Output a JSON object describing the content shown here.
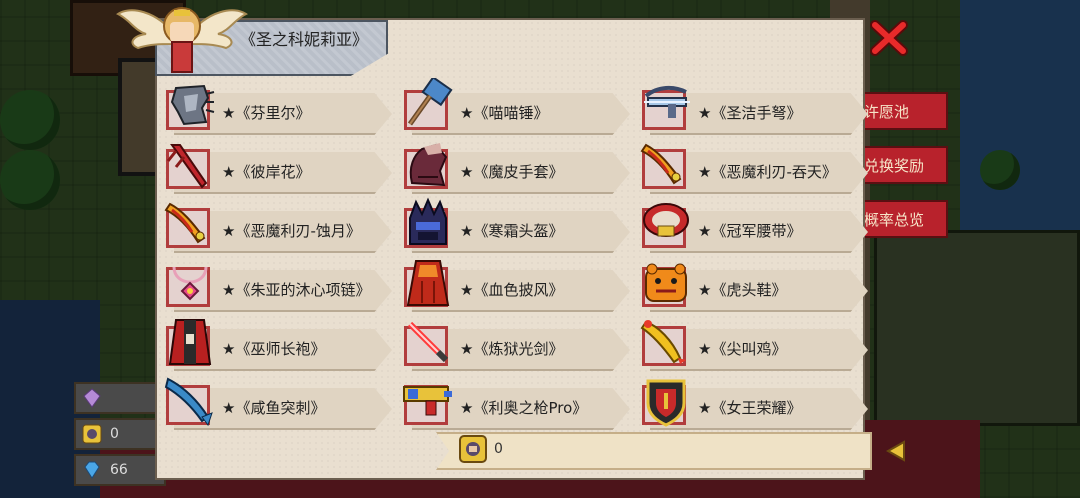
{
  "title": "《圣之科妮莉亚》",
  "items": [
    {
      "label": "★《芬里尔》",
      "icon": "claw-gauntlet-icon"
    },
    {
      "label": "★《喵喵锤》",
      "icon": "hammer-icon"
    },
    {
      "label": "★《圣洁手弩》",
      "icon": "crossbow-icon"
    },
    {
      "label": "★《彼岸花》",
      "icon": "red-blade-icon"
    },
    {
      "label": "★《魔皮手套》",
      "icon": "glove-icon"
    },
    {
      "label": "★《恶魔利刃-吞天》",
      "icon": "demon-blade-icon"
    },
    {
      "label": "★《恶魔利刃-蚀月》",
      "icon": "demon-blade-icon"
    },
    {
      "label": "★《寒霜头盔》",
      "icon": "frost-helmet-icon"
    },
    {
      "label": "★《冠军腰带》",
      "icon": "belt-icon"
    },
    {
      "label": "★《朱亚的沐心项链》",
      "icon": "necklace-icon"
    },
    {
      "label": "★《血色披风》",
      "icon": "cape-icon"
    },
    {
      "label": "★《虎头鞋》",
      "icon": "tiger-shoes-icon"
    },
    {
      "label": "★《巫师长袍》",
      "icon": "robe-icon"
    },
    {
      "label": "★《炼狱光剑》",
      "icon": "lightsaber-icon"
    },
    {
      "label": "★《尖叫鸡》",
      "icon": "screaming-chicken-icon"
    },
    {
      "label": "★《咸鱼突刺》",
      "icon": "fish-icon"
    },
    {
      "label": "★《利奥之枪Pro》",
      "icon": "gun-icon"
    },
    {
      "label": "★《女王荣耀》",
      "icon": "shield-icon"
    }
  ],
  "footer": {
    "value": "0"
  },
  "side_tabs": [
    "许愿池",
    "兑换奖励",
    "概率总览"
  ],
  "resources": [
    {
      "icon": "purple-gem-icon",
      "value": ""
    },
    {
      "icon": "token-icon",
      "value": "0"
    },
    {
      "icon": "blue-diamond-icon",
      "value": "66"
    }
  ]
}
